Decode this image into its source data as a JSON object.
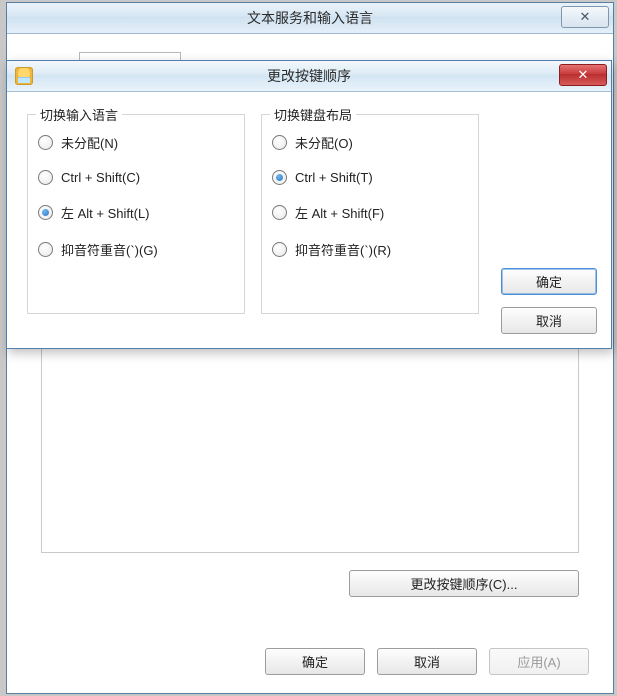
{
  "parent": {
    "title": "文本服务和输入语言",
    "close_glyph": "✕",
    "change_sequence_button": "更改按键顺序(C)...",
    "ok": "确定",
    "cancel": "取消",
    "apply": "应用(A)"
  },
  "modal": {
    "title": "更改按键顺序",
    "close_glyph": "✕",
    "ok": "确定",
    "cancel": "取消",
    "group_input": {
      "title": "切换输入语言",
      "options": [
        {
          "label": "未分配(N)",
          "checked": false
        },
        {
          "label": "Ctrl + Shift(C)",
          "checked": false
        },
        {
          "label": "左 Alt + Shift(L)",
          "checked": true
        },
        {
          "label": "抑音符重音(`)(G)",
          "checked": false
        }
      ]
    },
    "group_layout": {
      "title": "切换键盘布局",
      "options": [
        {
          "label": "未分配(O)",
          "checked": false
        },
        {
          "label": "Ctrl + Shift(T)",
          "checked": true
        },
        {
          "label": "左 Alt + Shift(F)",
          "checked": false
        },
        {
          "label": "抑音符重音(`)(R)",
          "checked": false
        }
      ]
    }
  }
}
